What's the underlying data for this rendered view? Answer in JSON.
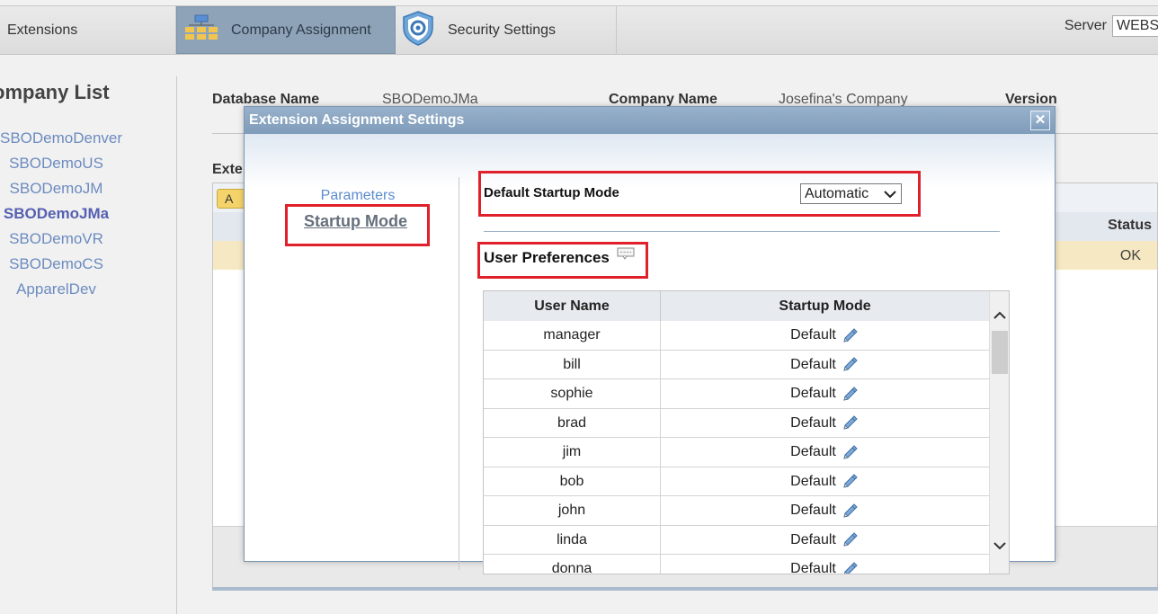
{
  "toolbar": {
    "extensions_label": "Extensions",
    "company_assignment_label": "Company Assignment",
    "security_settings_label": "Security Settings",
    "server_label": "Server",
    "server_value": "WEBS"
  },
  "company_list": {
    "title": "ompany List",
    "items": [
      "SBODemoDenver",
      "SBODemoUS",
      "SBODemoJM",
      "SBODemoJMa",
      "SBODemoVR",
      "SBODemoCS",
      "ApparelDev"
    ],
    "active_index": 3
  },
  "details": {
    "database_name_label": "Database Name",
    "database_name_value": "SBODemoJMa",
    "company_name_label": "Company Name",
    "company_name_value": "Josefina's Company",
    "version_label": "Version",
    "extensions_title": "Exte",
    "btn_label": "A",
    "status_header": "Status",
    "status_value": "OK"
  },
  "dialog": {
    "title": "Extension Assignment Settings",
    "close_symbol": "✕",
    "nav": {
      "parameters": "Parameters",
      "startup_mode": "Startup Mode"
    },
    "default_startup_mode_label": "Default Startup Mode",
    "default_startup_mode_value": "Automatic",
    "user_preferences_label": "User Preferences",
    "grid": {
      "headers": {
        "user_name": "User Name",
        "startup_mode": "Startup Mode"
      },
      "rows": [
        {
          "user": "manager",
          "mode": "Default"
        },
        {
          "user": "bill",
          "mode": "Default"
        },
        {
          "user": "sophie",
          "mode": "Default"
        },
        {
          "user": "brad",
          "mode": "Default"
        },
        {
          "user": "jim",
          "mode": "Default"
        },
        {
          "user": "bob",
          "mode": "Default"
        },
        {
          "user": "john",
          "mode": "Default"
        },
        {
          "user": "linda",
          "mode": "Default"
        },
        {
          "user": "donna",
          "mode": "Default"
        }
      ]
    }
  },
  "colors": {
    "highlight_red": "#e0202a",
    "link_blue": "#5b8bd0",
    "title_bar": "#8aa6c3",
    "selected_toolbar": "#8ea3b8"
  }
}
